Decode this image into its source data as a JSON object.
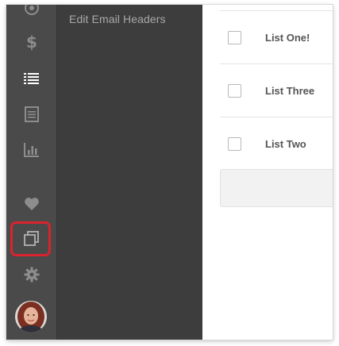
{
  "sidebar": {
    "icons": [
      {
        "name": "dashboard-icon"
      },
      {
        "name": "dollar-icon"
      },
      {
        "name": "list-icon"
      },
      {
        "name": "document-icon"
      },
      {
        "name": "bar-chart-icon"
      },
      {
        "name": "heart-icon"
      },
      {
        "name": "copy-icon"
      },
      {
        "name": "gear-icon"
      }
    ],
    "highlight_color": "#d9232e",
    "active_icon": "list-icon"
  },
  "subnav": {
    "items": [
      {
        "label": "Edit Email Headers"
      }
    ]
  },
  "lists": {
    "rows": [
      {
        "name": "List One!"
      },
      {
        "name": "List Three"
      },
      {
        "name": "List Two"
      }
    ]
  },
  "colors": {
    "rail": "#4a4a4a",
    "subnav": "#3d3d3d",
    "row_text": "#555555"
  }
}
